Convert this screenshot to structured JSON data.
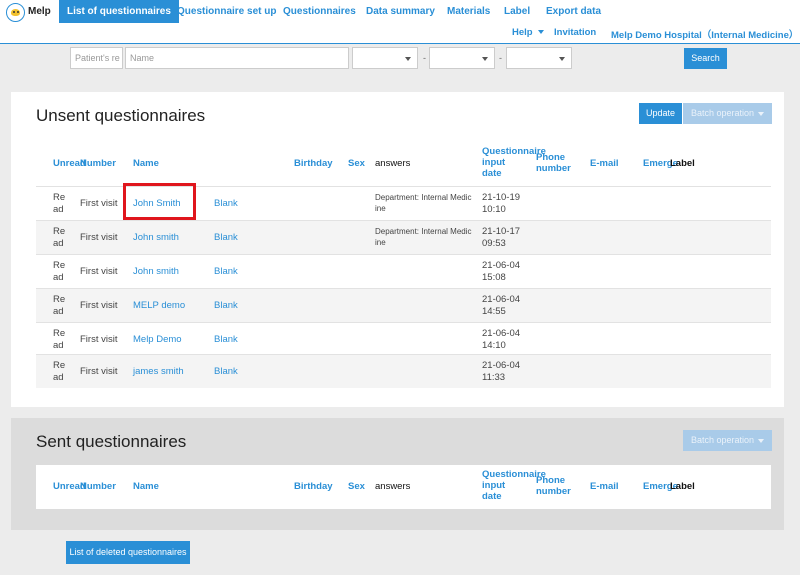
{
  "brand": "Melp",
  "nav": {
    "active": "List of questionnaires",
    "items": [
      "Questionnaire set up",
      "Questionnaires",
      "Data summary",
      "Materials",
      "Label",
      "Export data"
    ],
    "help": "Help",
    "invitation": "Invitation",
    "hospital": "Melp Demo Hospital（Internal Medicine）"
  },
  "search": {
    "patient_placeholder": "Patient's re",
    "name_placeholder": "Name",
    "dash": "-",
    "button": "Search"
  },
  "unsent": {
    "title": "Unsent questionnaires",
    "update": "Update",
    "batch": "Batch operation"
  },
  "sent": {
    "title": "Sent questionnaires",
    "batch": "Batch operation"
  },
  "columns": {
    "unread": "Unread",
    "number": "Number",
    "name": "Name",
    "birthday": "Birthday",
    "sex": "Sex",
    "answers": "answers",
    "input_date_1": "Questionnaire",
    "input_date_2": "input",
    "input_date_3": "date",
    "phone_1": "Phone",
    "phone_2": "number",
    "email": "E-mail",
    "emergency": "Emerge",
    "label": "Label"
  },
  "rows": [
    {
      "read1": "Re",
      "read2": "ad",
      "visit": "First visit",
      "name": "John Smith",
      "status": "Blank",
      "dept1": "Department: Internal Medic",
      "dept2": "ine",
      "date": "21-10-19",
      "time": "10:10"
    },
    {
      "read1": "Re",
      "read2": "ad",
      "visit": "First visit",
      "name": "John smith",
      "status": "Blank",
      "dept1": "Department: Internal Medic",
      "dept2": "ine",
      "date": "21-10-17",
      "time": "09:53"
    },
    {
      "read1": "Re",
      "read2": "ad",
      "visit": "First visit",
      "name": "John smith",
      "status": "Blank",
      "dept1": "",
      "dept2": "",
      "date": "21-06-04",
      "time": "15:08"
    },
    {
      "read1": "Re",
      "read2": "ad",
      "visit": "First visit",
      "name": "MELP demo",
      "status": "Blank",
      "dept1": "",
      "dept2": "",
      "date": "21-06-04",
      "time": "14:55"
    },
    {
      "read1": "Re",
      "read2": "ad",
      "visit": "First visit",
      "name": "Melp Demo",
      "status": "Blank",
      "dept1": "",
      "dept2": "",
      "date": "21-06-04",
      "time": "14:10"
    },
    {
      "read1": "Re",
      "read2": "ad",
      "visit": "First visit",
      "name": "james smith",
      "status": "Blank",
      "dept1": "",
      "dept2": "",
      "date": "21-06-04",
      "time": "11:33"
    }
  ],
  "deleted_button": "List of deleted questionnaires"
}
